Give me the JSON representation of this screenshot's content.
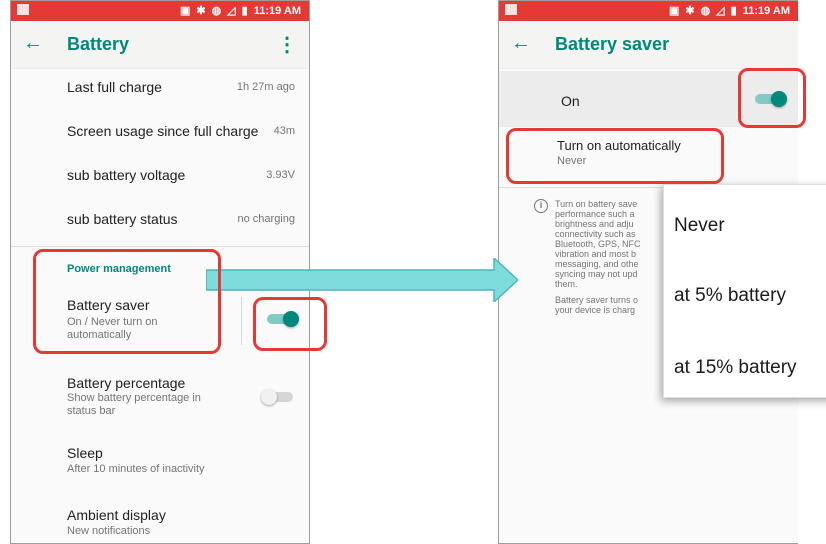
{
  "status_bar": {
    "time": "11:19 AM",
    "icons": [
      "nfc-icon",
      "bluetooth-icon",
      "vibrate-icon",
      "signal-icon",
      "battery-icon"
    ]
  },
  "left_screen": {
    "title": "Battery",
    "rows": [
      {
        "label": "Last full charge",
        "value": "1h 27m ago"
      },
      {
        "label": "Screen usage since full charge",
        "value": "43m"
      },
      {
        "label": "sub battery voltage",
        "value": "3.93V"
      },
      {
        "label": "sub battery status",
        "value": "no charging"
      }
    ],
    "section_header": "Power management",
    "battery_saver": {
      "label": "Battery saver",
      "summary": "On / Never turn on\nautomatically",
      "enabled": true
    },
    "battery_percentage": {
      "label": "Battery percentage",
      "summary": "Show battery percentage in\nstatus bar",
      "enabled": false
    },
    "sleep": {
      "label": "Sleep",
      "summary": "After 10 minutes of inactivity"
    },
    "ambient": {
      "label": "Ambient display",
      "summary": "New notifications"
    }
  },
  "right_screen": {
    "title": "Battery saver",
    "master_switch": {
      "label": "On",
      "enabled": true
    },
    "auto": {
      "label": "Turn on automatically",
      "summary": "Never"
    },
    "info_paragraph_1": "Turn on battery save\nperformance such a\nbrightness and adju\nconnectivity such as\nBluetooth, GPS, NFC\nvibration and most b\nmessaging, and othe\nsyncing may not upd\nthem.",
    "info_paragraph_2": "Battery saver turns o\nyour device is charg"
  },
  "popup_options": [
    "Never",
    "at 5% battery",
    "at 15% battery"
  ],
  "colors": {
    "accent": "#00897b",
    "status_bar": "#e53935",
    "highlight": "#e53935",
    "arrow": "#7fdcdc"
  }
}
